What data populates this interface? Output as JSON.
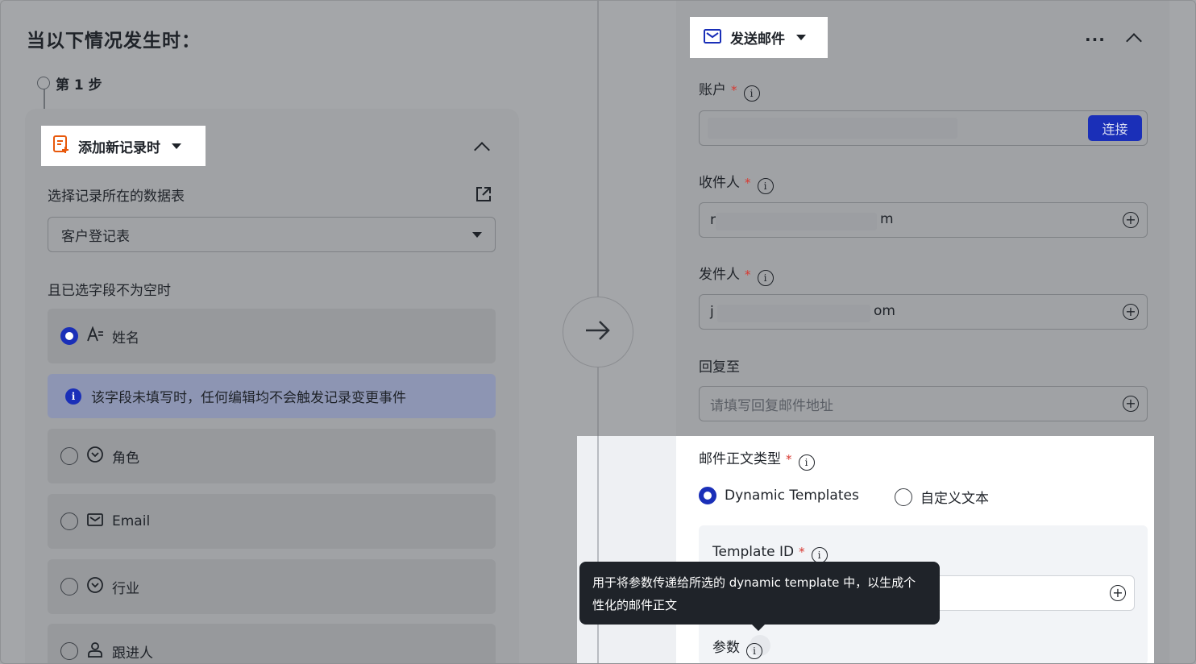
{
  "header": {
    "title": "当以下情况发生时："
  },
  "step": {
    "label": "第 1 步"
  },
  "trigger": {
    "label": "添加新记录时",
    "table_label": "选择记录所在的数据表",
    "table_value": "客户登记表",
    "condition_label": "且已选字段不为空时",
    "fields": [
      {
        "label": "姓名",
        "icon": "text-field-icon",
        "selected": true
      },
      {
        "label": "角色",
        "icon": "select-field-icon",
        "selected": false
      },
      {
        "label": "Email",
        "icon": "email-field-icon",
        "selected": false
      },
      {
        "label": "行业",
        "icon": "select-field-icon",
        "selected": false
      },
      {
        "label": "跟进人",
        "icon": "person-field-icon",
        "selected": false
      }
    ],
    "info_text": "该字段未填写时，任何编辑均不会触发记录变更事件"
  },
  "action": {
    "label": "发送邮件",
    "more": "···",
    "account_label": "账户",
    "connect_label": "连接",
    "recipient_label": "收件人",
    "recipient_start": "r",
    "recipient_end": "m",
    "sender_label": "发件人",
    "sender_start": "j",
    "sender_end": "om",
    "reply_label": "回复至",
    "reply_placeholder": "请填写回复邮件地址",
    "body_type_label": "邮件正文类型",
    "body_types": [
      "Dynamic Templates",
      "自定义文本"
    ],
    "template_id_label": "Template ID",
    "params_label": "参数"
  },
  "tooltip": {
    "text": "用于将参数传递给所选的 dynamic template 中，以生成个性化的邮件正文"
  },
  "colors": {
    "accent": "#1a2fb8",
    "trigger_icon": "#e8590c",
    "required": "#d83931"
  }
}
